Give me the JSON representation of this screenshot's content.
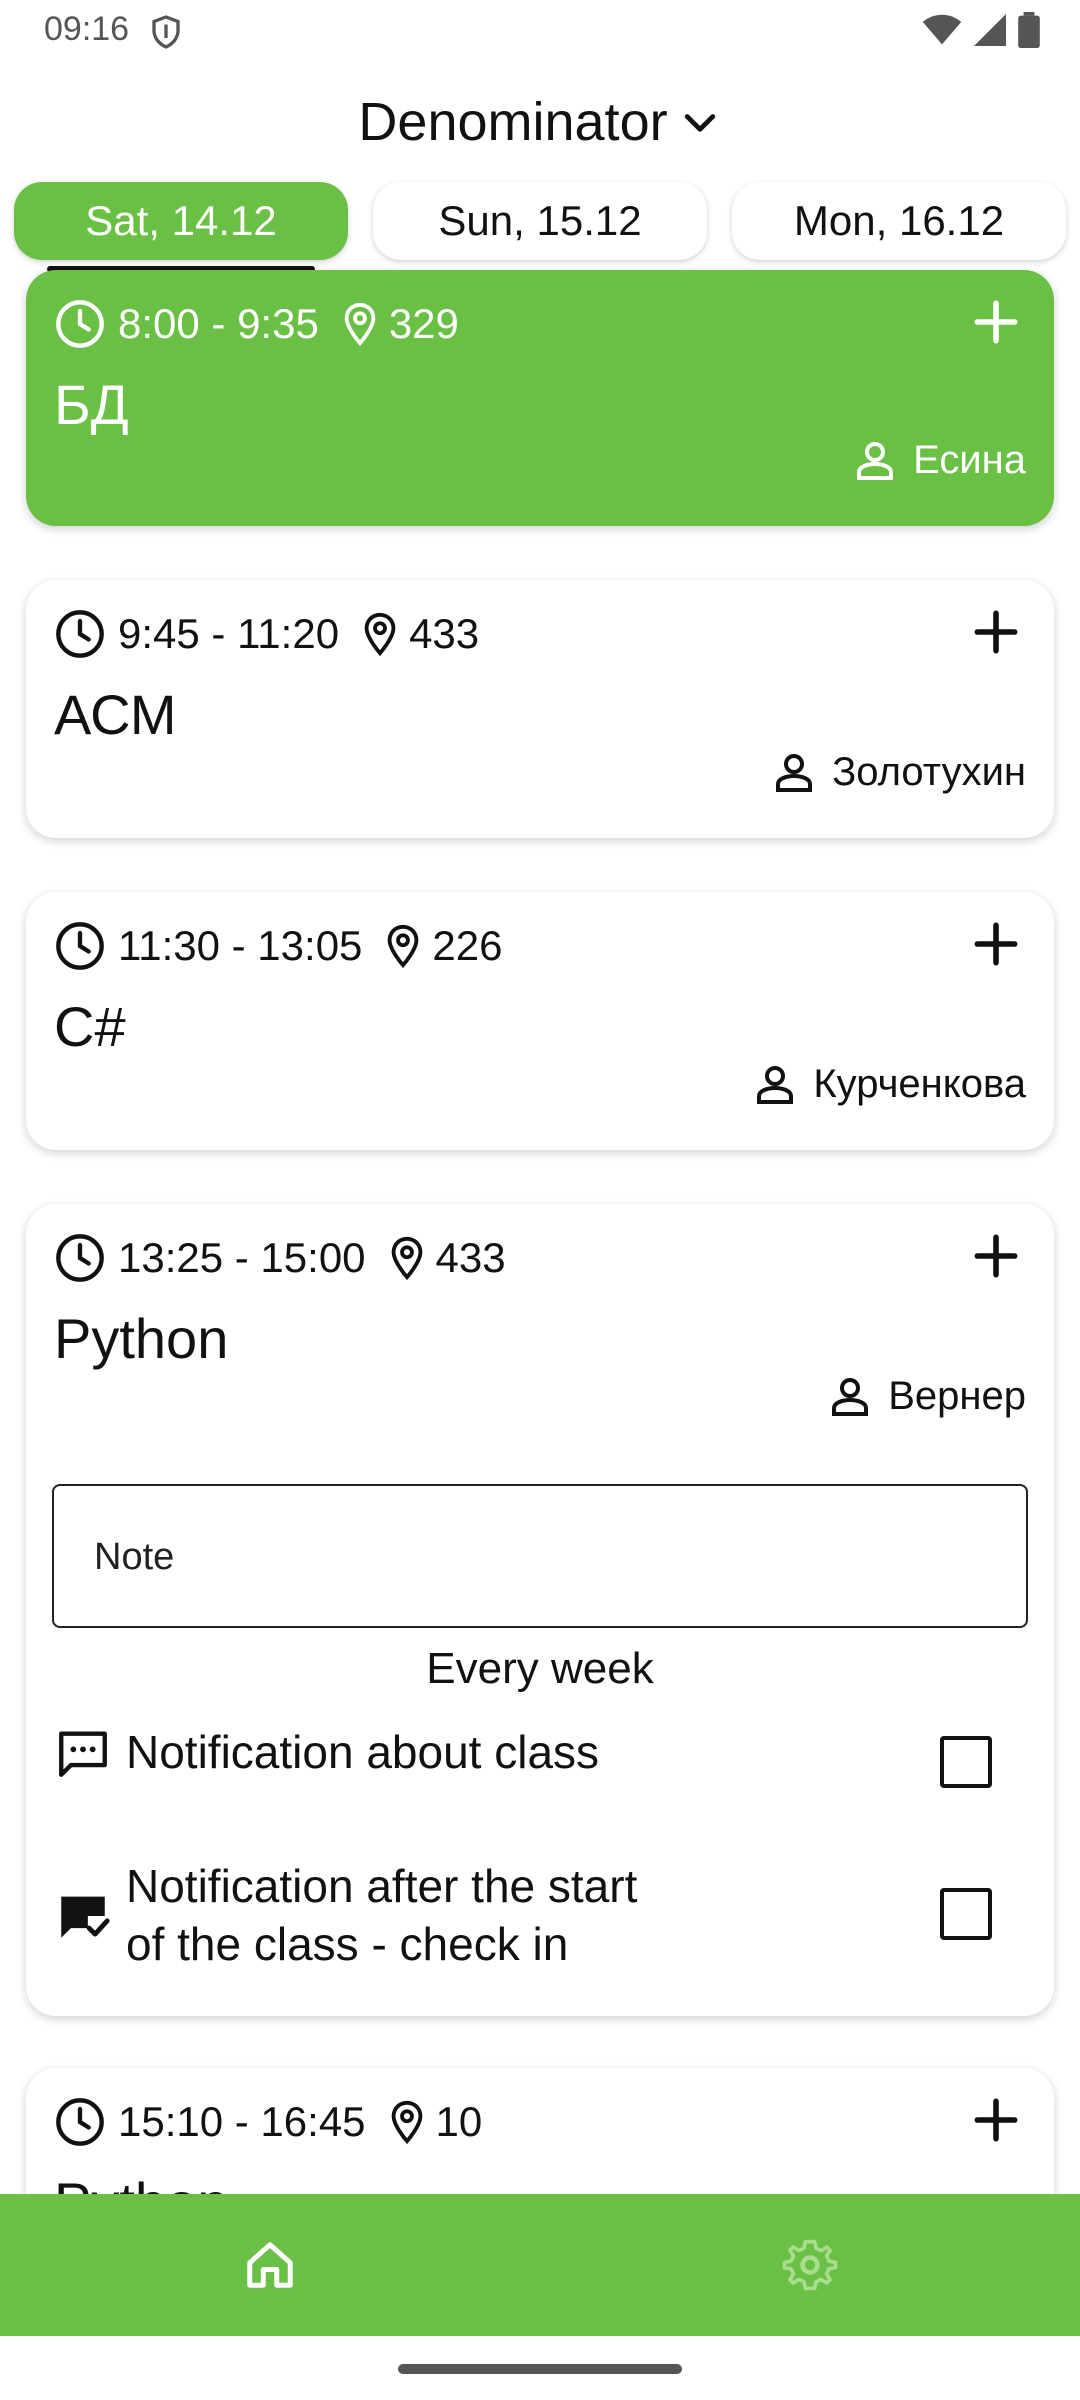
{
  "status_bar": {
    "time": "09:16"
  },
  "header": {
    "title": "Denominator"
  },
  "day_tabs": [
    {
      "label": "Sat, 14.12"
    },
    {
      "label": "Sun, 15.12"
    },
    {
      "label": "Mon, 16.12"
    }
  ],
  "classes": [
    {
      "time": "8:00 - 9:35",
      "room": "329",
      "subject": "БД",
      "teacher": "Есина"
    },
    {
      "time": "9:45 - 11:20",
      "room": "433",
      "subject": "АСМ",
      "teacher": "Золотухин"
    },
    {
      "time": "11:30 - 13:05",
      "room": "226",
      "subject": "C#",
      "teacher": "Курченкова"
    },
    {
      "time": "13:25 - 15:00",
      "room": "433",
      "subject": "Python",
      "teacher": "Вернер",
      "note_placeholder": "Note",
      "repeat": "Every week",
      "notification_1": "Notification about class",
      "notification_2_line1": "Notification after the start",
      "notification_2_line2": "of the class - check in"
    },
    {
      "time": "15:10 - 16:45",
      "room": "10",
      "subject": "Python"
    }
  ],
  "colors": {
    "accent": "#6abf45",
    "text": "#111111"
  }
}
